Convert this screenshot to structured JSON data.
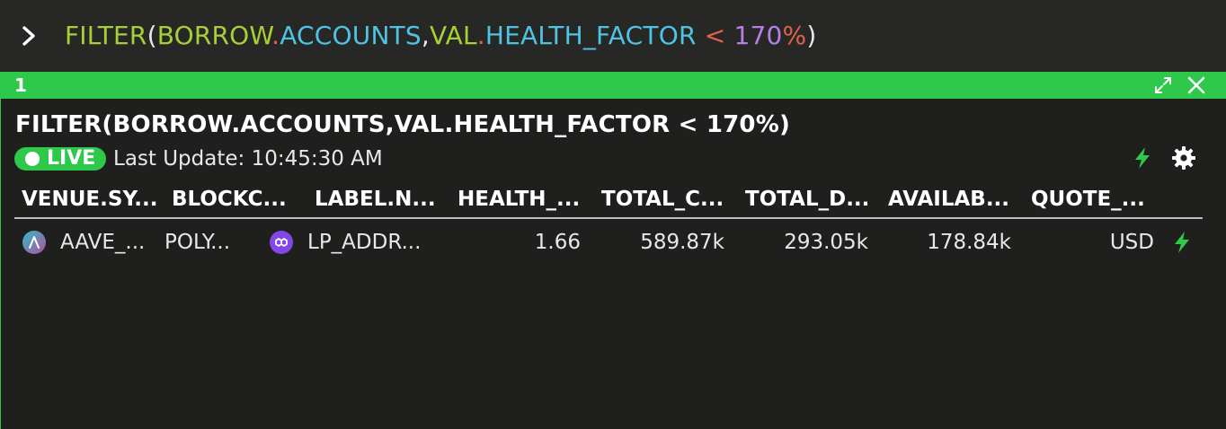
{
  "command": {
    "prompt_icon": "chevron-right-icon",
    "tokens": {
      "fn": "FILTER",
      "open": "(",
      "obj1": "BORROW",
      "dot1": ".",
      "prop1": "ACCOUNTS",
      "comma": ",",
      "obj2": "VAL",
      "dot2": ".",
      "prop2": "HEALTH_FACTOR",
      "op": " < ",
      "num": "170",
      "pct": "%",
      "close": ")"
    }
  },
  "panel": {
    "index": "1",
    "accent": "#2ec94a",
    "title": "FILTER(BORROW.ACCOUNTS,VAL.HEALTH_FACTOR < 170%)",
    "live_label": "LIVE",
    "last_update": "Last Update: 10:45:30 AM",
    "header_icons": [
      "expand-icon",
      "close-icon"
    ],
    "tool_icons": [
      "lightning-icon",
      "gear-icon"
    ]
  },
  "table": {
    "columns": [
      "VENUE.SY...",
      "BLOCKC...",
      "LABEL.N...",
      "HEALTH_...",
      "TOTAL_C...",
      "TOTAL_D...",
      "AVAILAB...",
      "QUOTE_..."
    ],
    "rows": [
      {
        "venue": "AAVE_...",
        "venue_icon": "aave-logo-icon",
        "blockchain": "POLY...",
        "label": "LP_ADDR...",
        "label_icon": "polygon-logo-icon",
        "health": "1.66",
        "total_c": "589.87k",
        "total_d": "293.05k",
        "available": "178.84k",
        "quote": "USD",
        "row_icon": "lightning-icon"
      }
    ]
  }
}
